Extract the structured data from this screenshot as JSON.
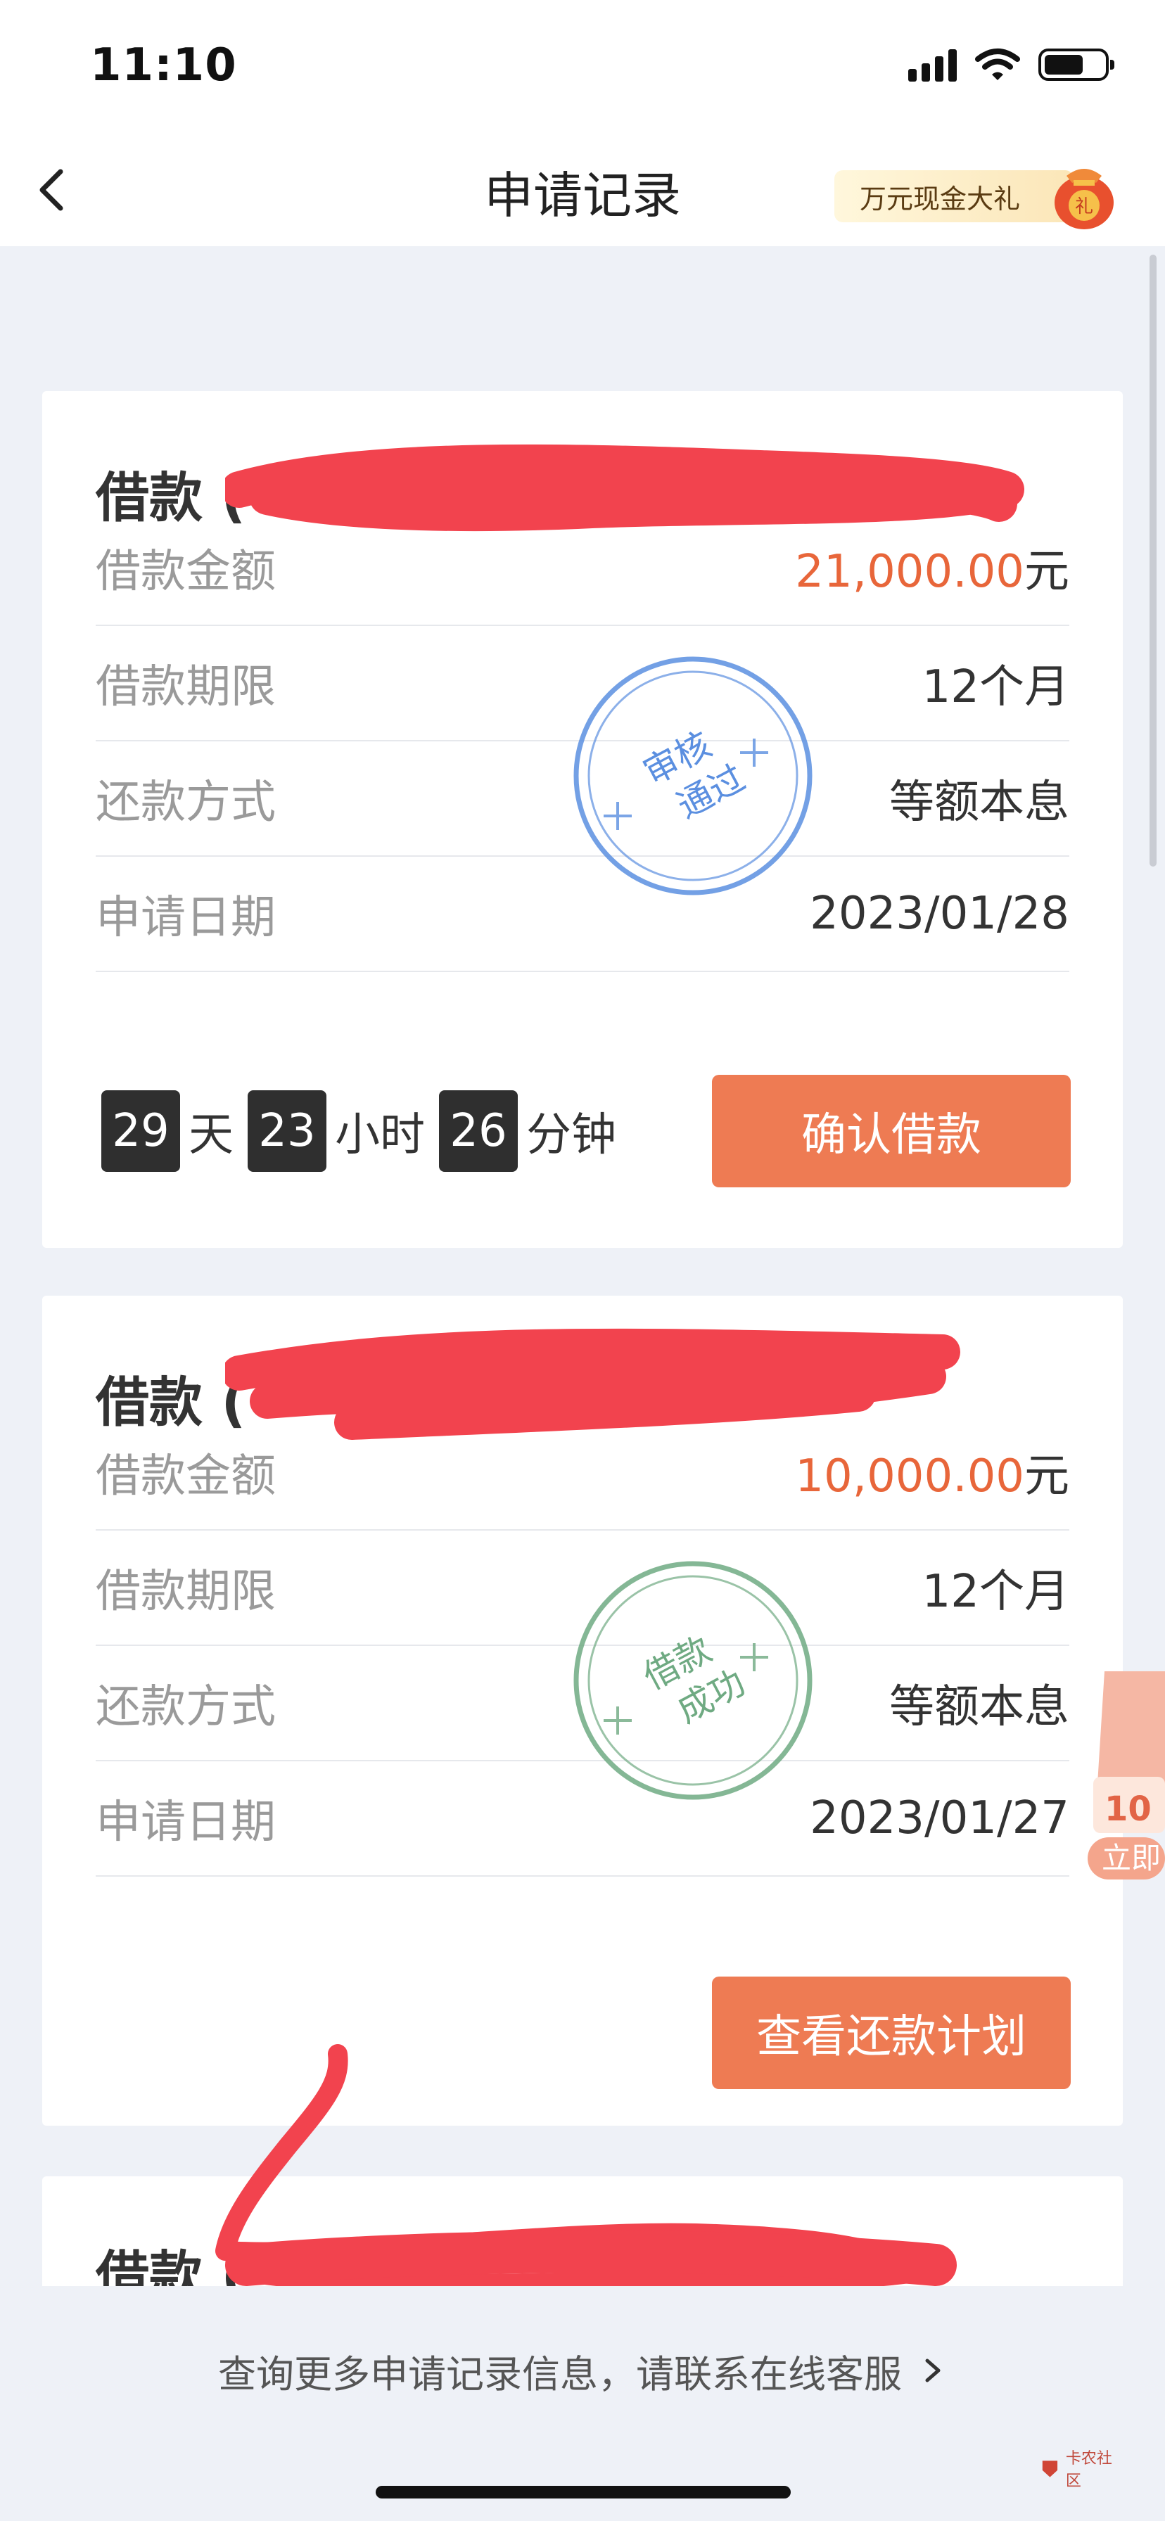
{
  "status_bar": {
    "time": "11:10"
  },
  "nav": {
    "title": "申请记录",
    "promo_label": "万元现金大礼",
    "promo_bag_glyph": "礼"
  },
  "cards": [
    {
      "title": "借款 (",
      "rows": [
        {
          "label": "借款金额",
          "value": "21,000.00",
          "unit": "元"
        },
        {
          "label": "借款期限",
          "value": "12个月"
        },
        {
          "label": "还款方式",
          "value": "等额本息"
        },
        {
          "label": "申请日期",
          "value": "2023/01/28"
        }
      ],
      "stamp": {
        "line1": "审核",
        "line2": "通过",
        "color": "#5b8fe0"
      },
      "countdown": {
        "days": "29",
        "days_unit": "天",
        "hours": "23",
        "hours_unit": "小时",
        "minutes": "26",
        "minutes_unit": "分钟"
      },
      "action": "确认借款"
    },
    {
      "title": "借款 (",
      "rows": [
        {
          "label": "借款金额",
          "value": "10,000.00",
          "unit": "元"
        },
        {
          "label": "借款期限",
          "value": "12个月"
        },
        {
          "label": "还款方式",
          "value": "等额本息"
        },
        {
          "label": "申请日期",
          "value": "2023/01/27"
        }
      ],
      "stamp": {
        "line1": "借款",
        "line2": "成功",
        "color": "#6faa82"
      },
      "action": "查看还款计划"
    },
    {
      "title": "借款 ("
    }
  ],
  "side_badge": {
    "line1": "10",
    "line2": "立即"
  },
  "footer": {
    "text": "查询更多申请记录信息，请联系在线客服"
  },
  "watermark": {
    "text": "卡农社区"
  },
  "colors": {
    "accent_orange": "#ee7b53",
    "amount_orange": "#e8663a",
    "redaction_red": "#f2434e",
    "page_bg": "#eef1f7"
  }
}
